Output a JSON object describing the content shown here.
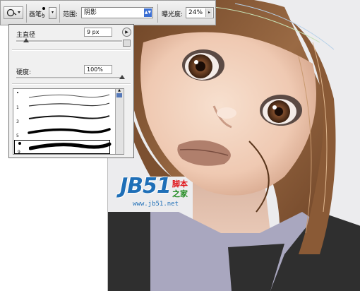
{
  "options_bar": {
    "tool_icon": "dodge-burn-icon",
    "brush_label": "画笔:",
    "brush_size": "9",
    "range_label": "范围:",
    "range_value": "阴影",
    "exposure_label": "曝光度:",
    "exposure_value": "24%"
  },
  "brush_panel": {
    "master_diameter_label": "主直径",
    "master_diameter_value": "9 px",
    "master_diameter_level": 0.09,
    "hardness_label": "硬度:",
    "hardness_value": "100%",
    "hardness_level": 1.0,
    "presets": [
      {
        "size": "1"
      },
      {
        "size": "3"
      },
      {
        "size": "5"
      },
      {
        "size": "9",
        "selected": true
      }
    ]
  },
  "watermark": {
    "logo": "JB51",
    "cn_line1": "脚本",
    "cn_line2": "之家",
    "url": "www.jb51.net"
  },
  "colors": {
    "hair": "#8a5a36",
    "skin": "#f2cfb8",
    "lips": "#b07f6c",
    "collar": "#a9a7bf",
    "dress": "#2f2f2f",
    "accent_blue": "#3b6fd3"
  }
}
